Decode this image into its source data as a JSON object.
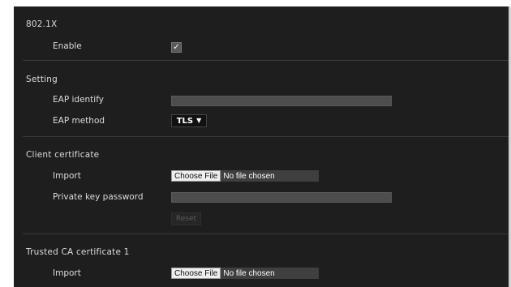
{
  "sections": {
    "dot1x": {
      "title": "802.1X",
      "enable_label": "Enable",
      "enable_checked": true
    },
    "setting": {
      "title": "Setting",
      "eap_identify_label": "EAP identify",
      "eap_identify_value": "",
      "eap_method_label": "EAP method",
      "eap_method_value": "TLS"
    },
    "client_certificate": {
      "title": "Client certificate",
      "import_label": "Import",
      "choose_file_label": "Choose File",
      "file_status": "No file chosen",
      "private_key_label": "Private key password",
      "private_key_value": "",
      "reset_label": "Reset"
    },
    "trusted_ca_1": {
      "title": "Trusted CA certificate 1",
      "import_label": "Import",
      "choose_file_label": "Choose File",
      "file_status": "No file chosen"
    }
  },
  "icons": {
    "checkbox_mark": "✓",
    "dropdown_arrow": "▼"
  },
  "colors": {
    "panel_bg": "#1e1e1e",
    "label_text": "#dcdcdc",
    "input_bg": "#4d4d4d",
    "divider": "#3a3a3a"
  }
}
